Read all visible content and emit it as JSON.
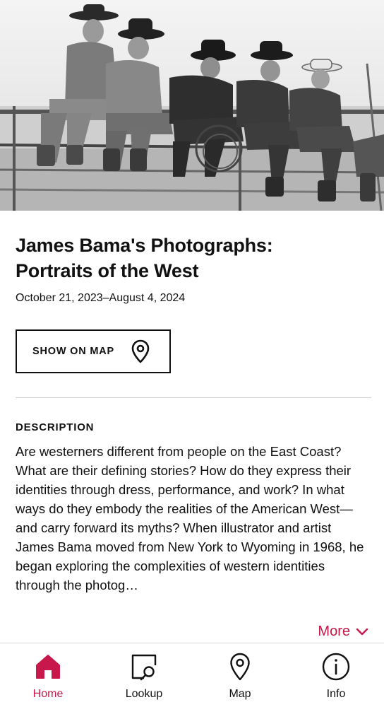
{
  "exhibition": {
    "title_line1": "James Bama's Photographs:",
    "title_line2": "Portraits of the West",
    "dates": "October 21, 2023–August 4, 2024"
  },
  "map_button": {
    "label": "SHOW ON MAP",
    "icon": "map-pin-icon"
  },
  "description": {
    "heading": "DESCRIPTION",
    "text": "Are westerners different from people on the East Coast? What are their defining stories? How do they express their identities through dress, performance, and work? In what ways do they embody the realities of the American West—and carry forward its myths? When illustrator and artist James Bama moved from New York to Wyoming in 1968, he began exploring the complexities of western identities through the photog…",
    "more_label": "More"
  },
  "tabs": [
    {
      "label": "Home",
      "icon": "home-icon",
      "active": true
    },
    {
      "label": "Lookup",
      "icon": "lookup-icon",
      "active": false
    },
    {
      "label": "Map",
      "icon": "map-pin-icon",
      "active": false
    },
    {
      "label": "Info",
      "icon": "info-icon",
      "active": false
    }
  ],
  "colors": {
    "accent": "#c8174a",
    "text": "#111111",
    "divider": "#cfcfcf"
  }
}
